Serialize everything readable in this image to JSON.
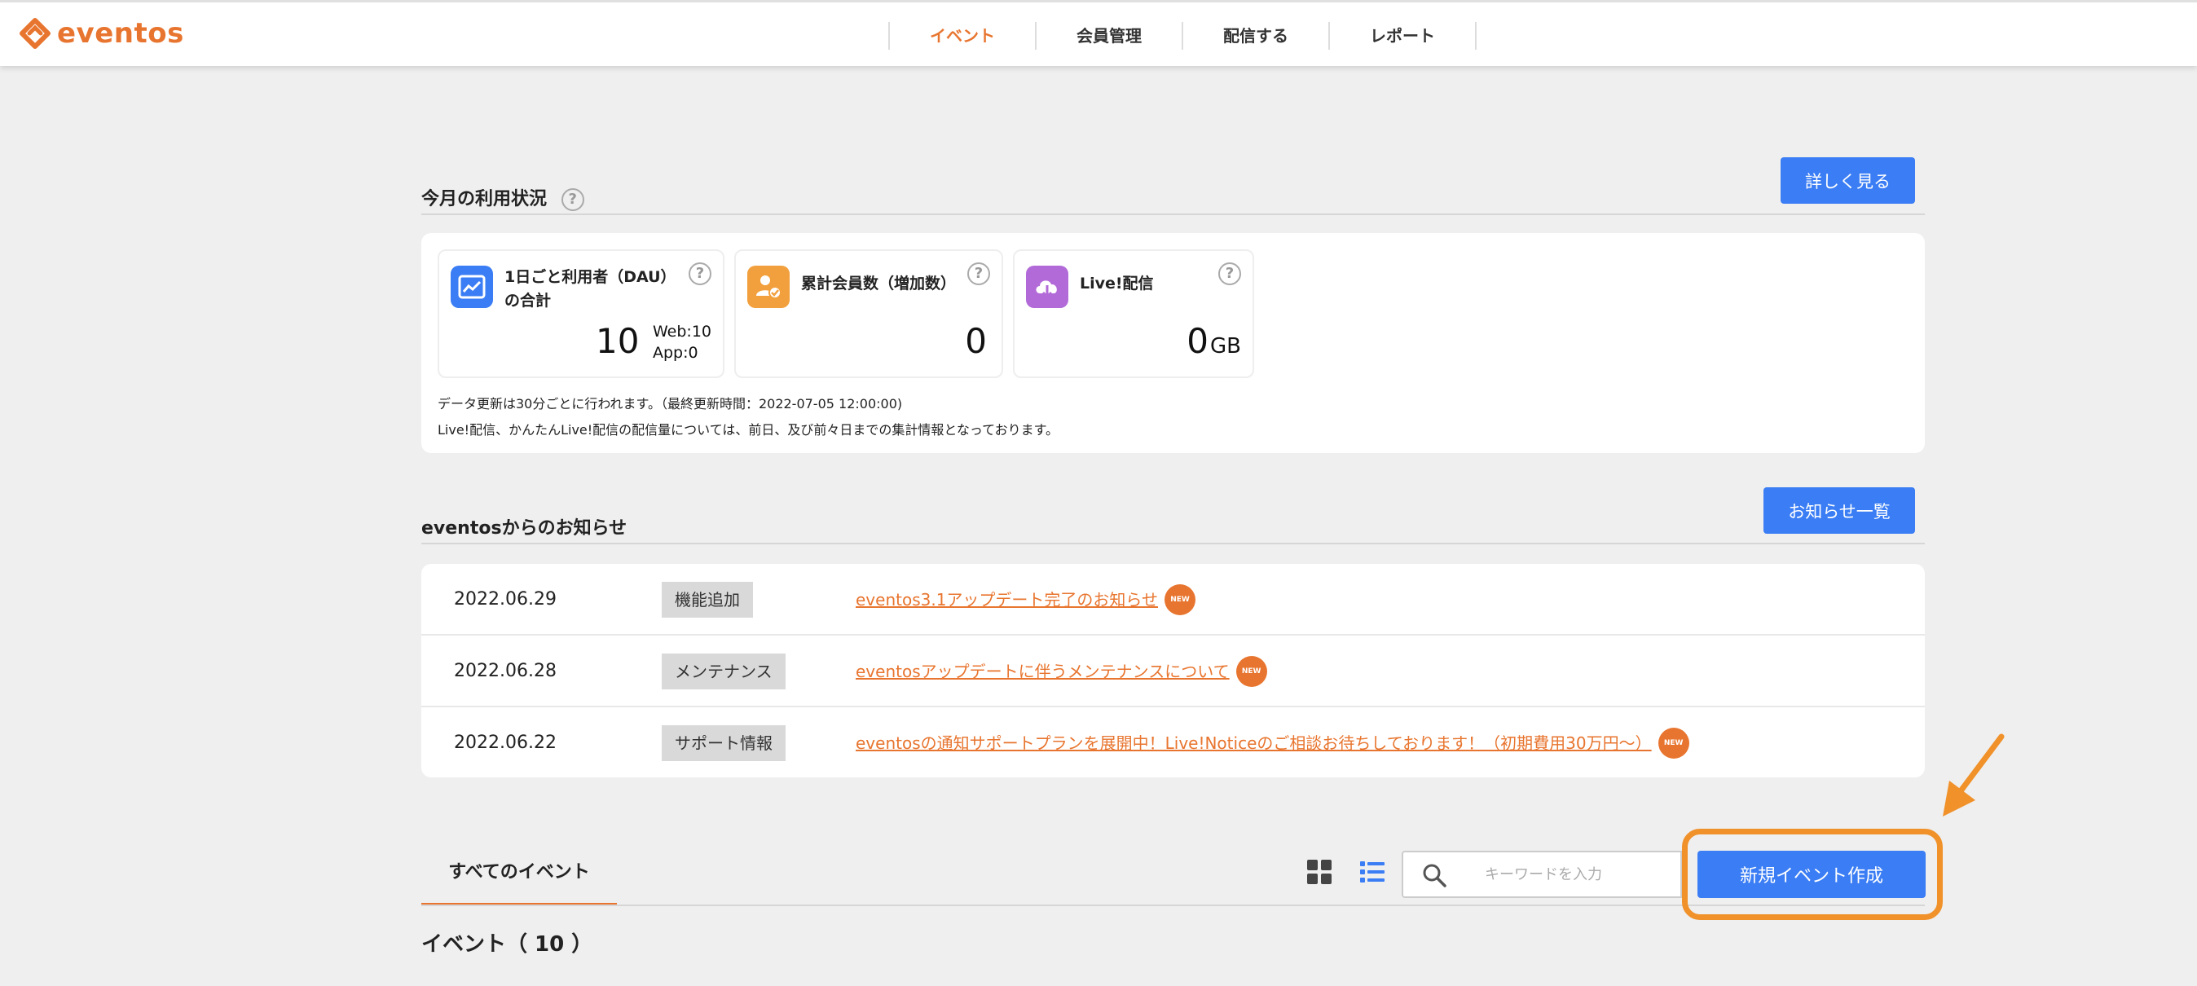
{
  "header": {
    "logo_text": "eventos",
    "nav": [
      "イベント",
      "会員管理",
      "配信する",
      "レポート"
    ],
    "active_nav": "イベント",
    "accent": "#e8752f"
  },
  "usage": {
    "title": "今月の利用状況",
    "details_button": "詳しく見る",
    "cards": [
      {
        "label_line1": "1日ごと利用者（DAU）",
        "label_line2": "の合計",
        "value": "10",
        "web": "Web:10",
        "app": "App:0",
        "icon": "chart-icon",
        "icon_color": "#3a7df4"
      },
      {
        "label_line1": "累計会員数（増加数）",
        "value": "0",
        "icon": "member-check-icon",
        "icon_color": "#f2a03d"
      },
      {
        "label_line1": "Live!配信",
        "value": "0",
        "unit": "GB",
        "icon": "cloud-download-icon",
        "icon_color": "#b26ad8"
      }
    ],
    "note1": "データ更新は30分ごとに行われます。（最終更新時間：2022-07-05 12:00:00)",
    "note2": "Live!配信、かんたんLive!配信の配信量については、前日、及び前々日までの集計情報となっております。"
  },
  "news": {
    "title": "eventosからのお知らせ",
    "list_button": "お知らせ一覧",
    "badge": "NEW",
    "items": [
      {
        "date": "2022.06.29",
        "tag": "機能追加",
        "text": "eventos3.1アップデート完了のお知らせ"
      },
      {
        "date": "2022.06.28",
        "tag": "メンテナンス",
        "text": "eventosアップデートに伴うメンテナンスについて"
      },
      {
        "date": "2022.06.22",
        "tag": "サポート情報",
        "text": "eventosの通知サポートプランを展開中！Live!Noticeのご相談お待ちしております！（初期費用30万円〜）"
      }
    ]
  },
  "events": {
    "tab_all": "すべてのイベント",
    "search_placeholder": "キーワードを入力",
    "new_button": "新規イベント作成",
    "list_title": "イベント（ 10 ）"
  }
}
